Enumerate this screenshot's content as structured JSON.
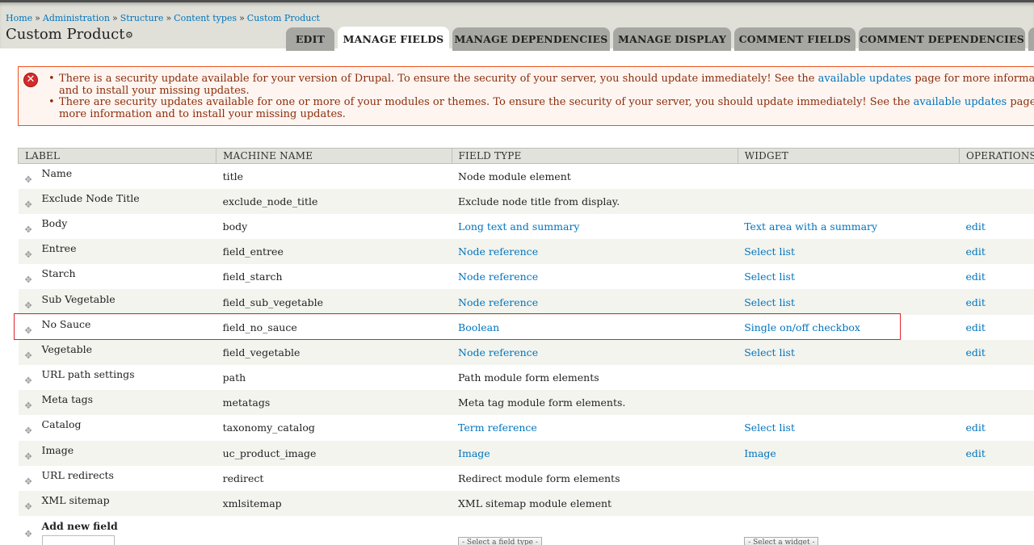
{
  "breadcrumb": [
    "Home",
    "Administration",
    "Structure",
    "Content types",
    "Custom Product"
  ],
  "breadcrumb_separator": "»",
  "page_title": "Custom Product",
  "gear_icon": "⚙",
  "tabs": [
    {
      "label": "EDIT",
      "active": false
    },
    {
      "label": "MANAGE FIELDS",
      "active": true
    },
    {
      "label": "MANAGE DEPENDENCIES",
      "active": false
    },
    {
      "label": "MANAGE DISPLAY",
      "active": false
    },
    {
      "label": "COMMENT FIELDS",
      "active": false
    },
    {
      "label": "COMMENT DEPENDENCIES",
      "active": false
    }
  ],
  "messages": [
    {
      "before": "There is a security update available for your version of Drupal. To ensure the security of your server, you should update immediately! See the ",
      "link": "available updates",
      "after": " page for more information and to install your missing updates."
    },
    {
      "before": "There are security updates available for one or more of your modules or themes. To ensure the security of your server, you should update immediately! See the ",
      "link": "available updates",
      "after": " page for more information and to install your missing updates."
    }
  ],
  "colors": {
    "error_border": "#ed541d",
    "error_text": "#8c2e0b",
    "link": "#0074bd",
    "highlight": "#e0232b"
  },
  "table": {
    "headers": [
      "LABEL",
      "MACHINE NAME",
      "FIELD TYPE",
      "WIDGET",
      "OPERATIONS"
    ],
    "rows": [
      {
        "label": "Name",
        "machine": "title",
        "type": "Node module element",
        "type_link": false,
        "widget": "",
        "op": ""
      },
      {
        "label": "Exclude Node Title",
        "machine": "exclude_node_title",
        "type": "Exclude node title from display.",
        "type_link": false,
        "widget": "",
        "op": ""
      },
      {
        "label": "Body",
        "machine": "body",
        "type": "Long text and summary",
        "type_link": true,
        "widget": "Text area with a summary",
        "op": "edit"
      },
      {
        "label": "Entree",
        "machine": "field_entree",
        "type": "Node reference",
        "type_link": true,
        "widget": "Select list",
        "op": "edit"
      },
      {
        "label": "Starch",
        "machine": "field_starch",
        "type": "Node reference",
        "type_link": true,
        "widget": "Select list",
        "op": "edit"
      },
      {
        "label": "Sub Vegetable",
        "machine": "field_sub_vegetable",
        "type": "Node reference",
        "type_link": true,
        "widget": "Select list",
        "op": "edit"
      },
      {
        "label": "No Sauce",
        "machine": "field_no_sauce",
        "type": "Boolean",
        "type_link": true,
        "widget": "Single on/off checkbox",
        "op": "edit"
      },
      {
        "label": "Vegetable",
        "machine": "field_vegetable",
        "type": "Node reference",
        "type_link": true,
        "widget": "Select list",
        "op": "edit"
      },
      {
        "label": "URL path settings",
        "machine": "path",
        "type": "Path module form elements",
        "type_link": false,
        "widget": "",
        "op": ""
      },
      {
        "label": "Meta tags",
        "machine": "metatags",
        "type": "Meta tag module form elements.",
        "type_link": false,
        "widget": "",
        "op": ""
      },
      {
        "label": "Catalog",
        "machine": "taxonomy_catalog",
        "type": "Term reference",
        "type_link": true,
        "widget": "Select list",
        "op": "edit"
      },
      {
        "label": "Image",
        "machine": "uc_product_image",
        "type": "Image",
        "type_link": true,
        "widget": "Image",
        "op": "edit"
      },
      {
        "label": "URL redirects",
        "machine": "redirect",
        "type": "Redirect module form elements",
        "type_link": false,
        "widget": "",
        "op": ""
      },
      {
        "label": "XML sitemap",
        "machine": "xmlsitemap",
        "type": "XML sitemap module element",
        "type_link": false,
        "widget": "",
        "op": ""
      }
    ],
    "add_row": {
      "label": "Add new field",
      "field_type_placeholder": "- Select a field type -",
      "widget_placeholder": "- Select a widget -"
    }
  },
  "drag_icon": "✥",
  "error_icon": "✕",
  "highlighted_row": "No Sauce"
}
